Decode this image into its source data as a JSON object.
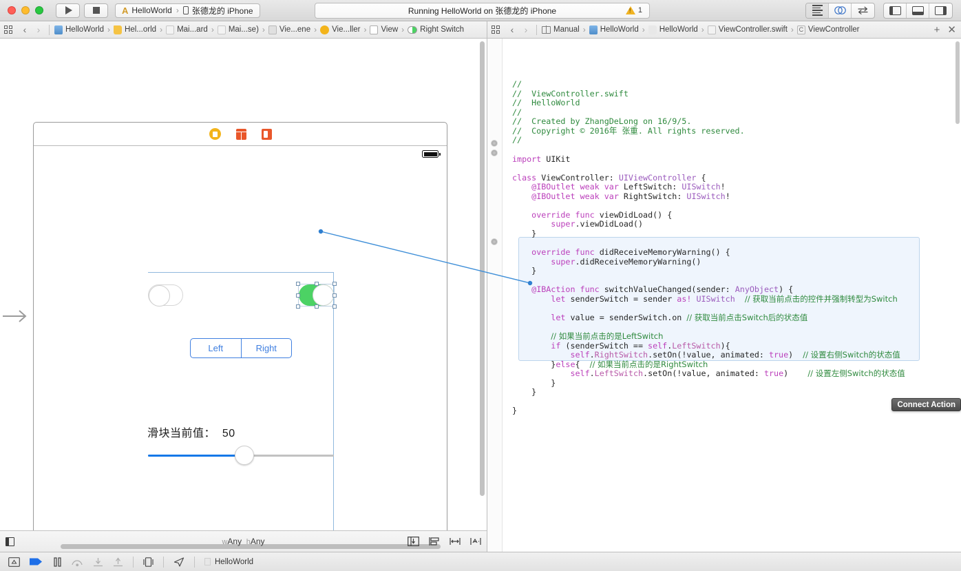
{
  "titlebar": {
    "run_label": "Run",
    "stop_label": "Stop",
    "scheme": "HelloWorld",
    "destination": "张德龙的 iPhone",
    "activity": "Running HelloWorld on 张德龙的 iPhone",
    "warning_count": "1",
    "editor_modes": [
      "standard-editor",
      "assistant-editor",
      "version-editor"
    ],
    "panel_toggles": [
      "navigator-toggle",
      "debug-area-toggle",
      "utilities-toggle"
    ]
  },
  "left_jumpbar": {
    "back": "‹",
    "forward": "›",
    "crumbs": [
      {
        "icon": "project-icon",
        "label": "HelloWorld"
      },
      {
        "icon": "folder-icon",
        "label": "Hel...orld"
      },
      {
        "icon": "file-icon",
        "label": "Mai...ard"
      },
      {
        "icon": "file-icon",
        "label": "Mai...se)"
      },
      {
        "icon": "storyboard-icon",
        "label": "Vie...ene"
      },
      {
        "icon": "viewcontroller-icon",
        "label": "Vie...ller"
      },
      {
        "icon": "view-icon",
        "label": "View"
      },
      {
        "icon": "switch-icon",
        "label": "Right Switch"
      }
    ]
  },
  "right_jumpbar": {
    "back": "‹",
    "forward": "›",
    "crumbs": [
      {
        "icon": "manual-icon",
        "label": "Manual"
      },
      {
        "icon": "project-icon",
        "label": "HelloWorld"
      },
      {
        "icon": "folder-icon",
        "label": "HelloWorld"
      },
      {
        "icon": "swift-file-icon",
        "label": "ViewController.swift"
      },
      {
        "icon": "class-icon",
        "label": "ViewController"
      }
    ],
    "add_label": "+",
    "close_label": "✕"
  },
  "canvas": {
    "dock_items": [
      "view-controller-icon",
      "first-responder-icon",
      "exit-icon"
    ],
    "left_switch": {
      "name": "LeftSwitch",
      "state": "off"
    },
    "right_switch": {
      "name": "RightSwitch",
      "state": "on",
      "selected": true
    },
    "segmented_control": {
      "segments": [
        "Left",
        "Right"
      ]
    },
    "slider_label": "滑块当前值：",
    "slider_value": "50",
    "slider_percent": 52
  },
  "ib_bottom": {
    "size_class_w": "w",
    "size_class_w_val": "Any",
    "size_class_h": "h",
    "size_class_h_val": "Any",
    "tools": [
      "embed-in-icon",
      "align-icon",
      "pin-icon",
      "resolve-auto-layout-icon"
    ]
  },
  "editor": {
    "tooltip": "Connect Action",
    "code": [
      {
        "line": "//",
        "type": "comment"
      },
      {
        "line": "//  ViewController.swift",
        "type": "comment"
      },
      {
        "line": "//  HelloWorld",
        "type": "comment"
      },
      {
        "line": "//",
        "type": "comment"
      },
      {
        "line": "//  Created by ZhangDeLong on 16/9/5.",
        "type": "comment"
      },
      {
        "line": "//  Copyright © 2016年 张重. All rights reserved.",
        "type": "comment"
      },
      {
        "line": "//",
        "type": "comment"
      },
      {
        "line": "",
        "type": "blank"
      },
      {
        "line": "import UIKit",
        "type": "code"
      },
      {
        "line": "",
        "type": "blank"
      },
      {
        "line": "class ViewController: UIViewController {",
        "type": "code"
      },
      {
        "line": "    @IBOutlet weak var LeftSwitch: UISwitch!",
        "type": "code"
      },
      {
        "line": "    @IBOutlet weak var RightSwitch: UISwitch!",
        "type": "code"
      },
      {
        "line": "",
        "type": "blank"
      },
      {
        "line": "    override func viewDidLoad() {",
        "type": "code"
      },
      {
        "line": "        super.viewDidLoad()",
        "type": "code"
      },
      {
        "line": "    }",
        "type": "code"
      },
      {
        "line": "",
        "type": "blank"
      },
      {
        "line": "    override func didReceiveMemoryWarning() {",
        "type": "code"
      },
      {
        "line": "        super.didReceiveMemoryWarning()",
        "type": "code"
      },
      {
        "line": "    }",
        "type": "code"
      },
      {
        "line": "",
        "type": "blank"
      },
      {
        "line": "    @IBAction func switchValueChanged(sender: AnyObject) {",
        "type": "code-highlighted"
      },
      {
        "line": "        let senderSwitch = sender as! UISwitch  // 获取当前点击的控件并强制转型为Switch",
        "type": "code-highlighted"
      },
      {
        "line": "",
        "type": "blank-highlighted"
      },
      {
        "line": "        let value = senderSwitch.on // 获取当前点击Switch后的状态值",
        "type": "code-highlighted"
      },
      {
        "line": "",
        "type": "blank-highlighted"
      },
      {
        "line": "        // 如果当前点击的是LeftSwitch",
        "type": "code-highlighted"
      },
      {
        "line": "        if (senderSwitch == self.LeftSwitch){",
        "type": "code-highlighted"
      },
      {
        "line": "            self.RightSwitch.setOn(!value, animated: true)  // 设置右侧Switch的状态值",
        "type": "code-highlighted"
      },
      {
        "line": "        }else{  // 如果当前点击的是RightSwitch",
        "type": "code-highlighted"
      },
      {
        "line": "            self.LeftSwitch.setOn(!value, animated: true)    // 设置左侧Switch的状态值",
        "type": "code-highlighted"
      },
      {
        "line": "        }",
        "type": "code-highlighted"
      },
      {
        "line": "    }",
        "type": "code-highlighted"
      },
      {
        "line": "",
        "type": "blank"
      },
      {
        "line": "}",
        "type": "code"
      }
    ]
  },
  "debugbar": {
    "scheme_label": "HelloWorld",
    "buttons": [
      "show-debug-area",
      "continue",
      "pause",
      "step-over",
      "step-into",
      "step-out",
      "view-hierarchy",
      "location-simulate"
    ]
  },
  "colors": {
    "switch_on": "#4cd264",
    "tint_blue": "#3f7fe0",
    "slider_fill": "#1578e8",
    "comment_green": "#2f8a3e",
    "keyword_magenta": "#bb3fbb",
    "type_purple": "#9b5bbd",
    "highlight_bg": "#eff5fd"
  }
}
